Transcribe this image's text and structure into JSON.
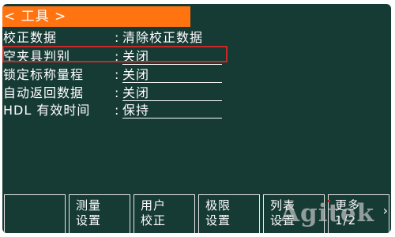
{
  "header": {
    "title": "< 工具 >"
  },
  "menu": {
    "items": [
      {
        "label": "校正数据",
        "value": "清除校正数据",
        "underlined": false
      },
      {
        "label": "空夹具判别",
        "value": "关闭",
        "underlined": true
      },
      {
        "label": "锁定标称量程",
        "value": "关闭",
        "underlined": true
      },
      {
        "label": "自动返回数据",
        "value": "关闭",
        "underlined": true
      },
      {
        "label": "HDL 有效时间",
        "value": "保持",
        "underlined": true
      }
    ],
    "separator": ":"
  },
  "softkeys": [
    {
      "line1": "",
      "line2": ""
    },
    {
      "line1": "测量",
      "line2": "设置"
    },
    {
      "line1": "用户",
      "line2": "校正"
    },
    {
      "line1": "极限",
      "line2": "设置"
    },
    {
      "line1": "列表",
      "line2": "设置"
    },
    {
      "line1": "更多",
      "line2": "1/2"
    }
  ],
  "watermark": {
    "text": "Agitek"
  },
  "colors": {
    "screen_background": "#163a34",
    "title_bar": "#ff7410",
    "selection_frame": "#c82828",
    "text": "#ffffff"
  }
}
